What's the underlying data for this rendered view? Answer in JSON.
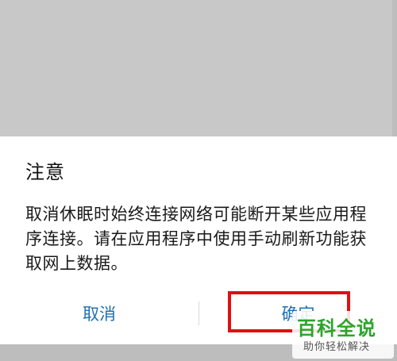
{
  "dialog": {
    "title": "注意",
    "message": "取消休眠时始终连接网络可能断开某些应用程序连接。请在应用程序中使用手动刷新功能获取网上数据。",
    "cancel_label": "取消",
    "confirm_label": "确定"
  },
  "watermark": {
    "main": "百科全说",
    "sub": "助你轻松解决"
  },
  "colors": {
    "button_text": "#1f6fb2",
    "highlight": "#e01010",
    "watermark_green": "#2aa52a"
  }
}
